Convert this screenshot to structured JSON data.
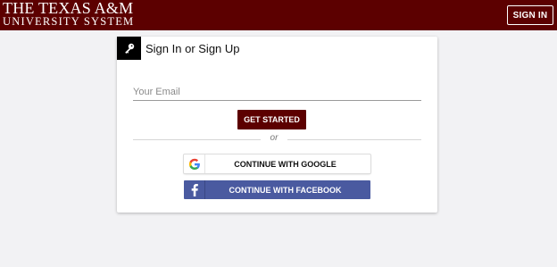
{
  "header": {
    "logo_line1": "THE TEXAS A&M",
    "logo_line2": "UNIVERSITY SYSTEM",
    "sign_in_label": "SIGN IN"
  },
  "card": {
    "title": "Sign In or Sign Up",
    "email_placeholder": "Your Email",
    "get_started_label": "GET STARTED",
    "divider_text": "or",
    "google_label": "CONTINUE WITH GOOGLE",
    "facebook_label": "CONTINUE WITH FACEBOOK"
  },
  "icons": {
    "key": "key-icon",
    "google": "google-icon",
    "facebook": "facebook-icon"
  },
  "colors": {
    "brand_maroon": "#5c0000",
    "facebook_blue": "#4a5aa0",
    "page_background": "#f2f2f4"
  }
}
